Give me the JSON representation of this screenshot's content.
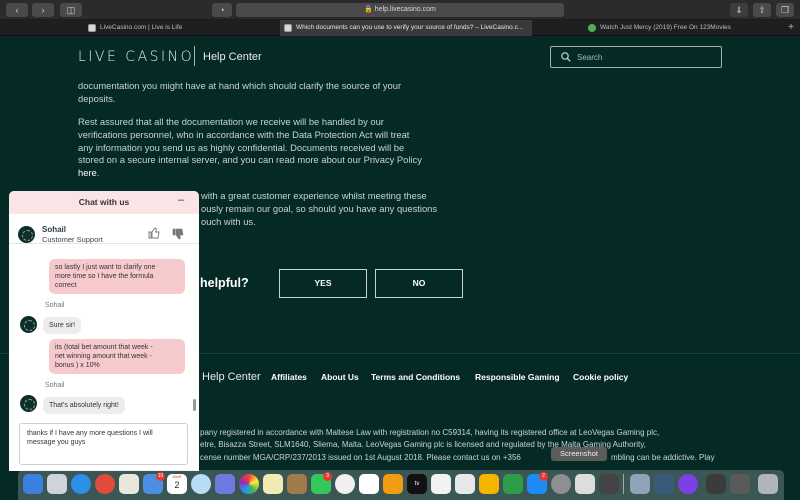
{
  "browser": {
    "url": "help.livecasino.com",
    "tabs": [
      {
        "label": "LiveCasino.com | Live is Life",
        "active": false
      },
      {
        "label": "Which documents can you use to verify your source of funds? – LiveCasino.c...",
        "active": true
      },
      {
        "label": "Watch Just Mercy (2019) Free On 123Movies",
        "active": false
      }
    ]
  },
  "header": {
    "logo": "LIVE CASINO",
    "section": "Help Center",
    "search_placeholder": "Search"
  },
  "article": {
    "p1_line1": "documentation you might have at hand which should clarify the source of your",
    "p1_line2": "deposits.",
    "p2_line1": "Rest assured that all the documentation we receive will be handled by our",
    "p2_line2": "verifications personnel, who in accordance with the Data Protection Act will treat",
    "p2_line3": "any information you send us as highly confidential. Documents received will be",
    "p2_line4": "stored on a secure internal server, and you can read more about our Privacy Policy",
    "p2_link": "here",
    "p2_end": ".",
    "p3_line1": "with a great customer experience whilst meeting these",
    "p3_line2": "ously remain our goal, so should you have any questions",
    "p3_line3": "ouch with us."
  },
  "feedback": {
    "question": "helpful?",
    "yes": "YES",
    "no": "NO"
  },
  "footer": {
    "section": "Help Center",
    "links": [
      "Affiliates",
      "About Us",
      "Terms and Conditions",
      "Responsible Gaming",
      "Cookie policy"
    ],
    "legal_line1": "pany registered in accordance with Maltese Law with registration no C59314, having its registered office at LeoVegas Gaming plc,",
    "legal_line2": "etre, Bisazza Street, SLM1640, Sliema, Malta. LeoVegas Gaming plc is licensed and regulated by the Malta Gaming Authority,",
    "legal_line3a": "cense number MGA/CRP/237/2013 issued on 1st August 2018. Please contact us on +356",
    "legal_line3b": "mbling can be addictive. Play",
    "tooltip": "Screenshot"
  },
  "chat": {
    "title": "Chat with us",
    "minimize": "–",
    "agent_name": "Sohail",
    "agent_role": "Customer Support",
    "messages": [
      {
        "from": "user",
        "text_l1": "so lastly I just want to clarify one",
        "text_l2": "more time so I have the formula",
        "text_l3": "correct"
      },
      {
        "from": "agent",
        "sender": "Sohail",
        "text": "Sure sir!"
      },
      {
        "from": "user",
        "text_l1": "its (total bet amount that week -",
        "text_l2": "net winning amount that week -",
        "text_l3": "bonus ) x 10%"
      },
      {
        "from": "agent",
        "sender": "Sohail",
        "text": "That's absolutely right!"
      }
    ],
    "input_value": "thanks if I have any more questions I will message you guys"
  },
  "dock": {
    "badge_mail": "10",
    "badge_calendar_month": "MAR",
    "badge_calendar_day": "2",
    "badge_facetime": "3",
    "badge_appstore": "2",
    "badge_tv": "tv"
  },
  "colors": {
    "page_bg": "#052a26",
    "chat_header": "#fbe4e6",
    "user_bubble": "#f6c9cc",
    "agent_bubble": "#ededed"
  }
}
